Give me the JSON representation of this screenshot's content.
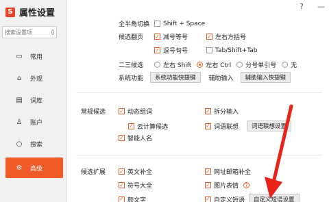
{
  "app": {
    "title": "属性设置",
    "logo_glyph": "S",
    "accent": "#f05a28"
  },
  "window": {
    "help": "?",
    "minimize": "—"
  },
  "search": {
    "placeholder": "搜索设置项"
  },
  "nav": [
    {
      "label": "常用",
      "icon": "monitor-icon",
      "glyph": "▭"
    },
    {
      "label": "外观",
      "icon": "shirt-icon",
      "glyph": "⌂"
    },
    {
      "label": "词库",
      "icon": "book-icon",
      "glyph": "▤"
    },
    {
      "label": "账户",
      "icon": "person-icon",
      "glyph": "♙"
    },
    {
      "label": "搜索",
      "icon": "search-icon",
      "glyph": "○"
    },
    {
      "label": "高级",
      "icon": "gear-icon",
      "glyph": "⚙",
      "active": true
    }
  ],
  "top": {
    "fullhalf_label": "全半角切换",
    "fullhalf_option": "Shift + Space",
    "page_label": "候选翻页",
    "page_opts": [
      "减号等号",
      "左右方括号",
      "逗号句号",
      "Tab/Shift+Tab"
    ],
    "page_checked": [
      true,
      true,
      true,
      false
    ],
    "second_label": "二三候选",
    "second_opts": [
      "左右 Shift",
      "左右 Ctrl",
      "分号单引号",
      "无"
    ],
    "second_selected": 1,
    "sysfunc_label": "系统功能",
    "sysfunc_btn": "系统功能快捷键",
    "aux_label": "辅助输入",
    "aux_btn": "辅助输入快捷键"
  },
  "regular": {
    "title": "常规候选",
    "items": [
      "动态组词",
      "拆分输入",
      "云计算候选",
      "词语联想",
      "智能人名"
    ],
    "assoc_btn": "词语联想设置"
  },
  "expand": {
    "title": "候选扩展",
    "items": [
      "英文补全",
      "网址邮箱补全",
      "符号大全",
      "图片表情",
      "颜文字",
      "自定义短语"
    ],
    "help": "?",
    "phrase_btn": "自定义短语设置"
  }
}
